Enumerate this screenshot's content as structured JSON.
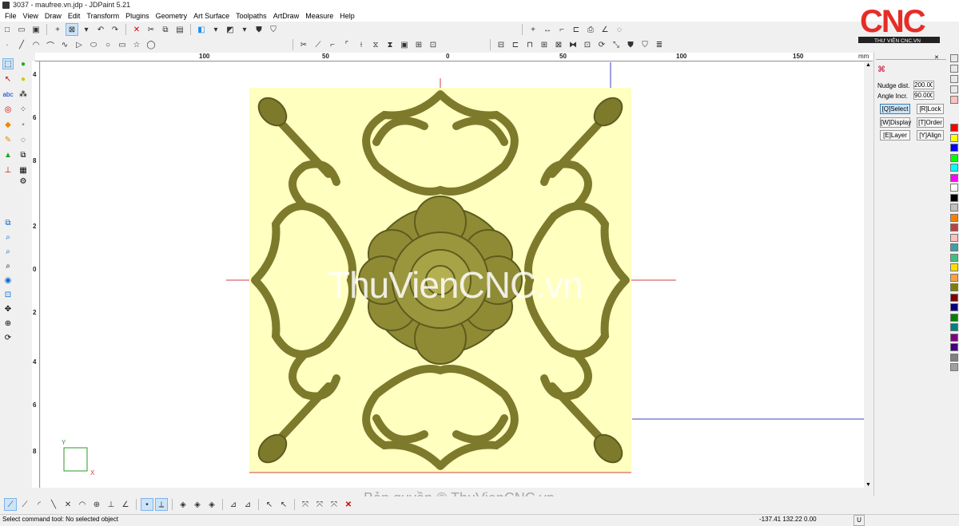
{
  "window": {
    "title": "3037 - maufree.vn.jdp - JDPaint 5.21"
  },
  "menu": [
    "File",
    "View",
    "Draw",
    "Edit",
    "Transform",
    "Plugins",
    "Geometry",
    "Art Surface",
    "Toolpaths",
    "ArtDraw",
    "Measure",
    "Help"
  ],
  "ruler_top": {
    "labels": [
      "100",
      "50",
      "0",
      "50",
      "100",
      "150"
    ],
    "unit": "mm"
  },
  "ruler_left": {
    "labels": [
      "4",
      "6",
      "8",
      "2",
      "0",
      "2",
      "4",
      "6",
      "8"
    ]
  },
  "right_panel": {
    "nudge_label": "Nudge dist.",
    "nudge_value": "200.000",
    "angle_label": "Angle Incr.",
    "angle_value": "90.000",
    "buttons": [
      "[Q]Select",
      "[R]Lock",
      "[W]Display",
      "[T]Order",
      "[E]Layer",
      "[Y]Align"
    ]
  },
  "palette": [
    "#ff0000",
    "#ffff00",
    "#0000ff",
    "#00ff00",
    "#00ffff",
    "#ff00ff",
    "#ffffff",
    "#000000",
    "#c0c0c0",
    "#ff8000",
    "#c04040",
    "#ffc0c0",
    "#40a0a0",
    "#40c080",
    "#ffe000",
    "#ffa040",
    "#808000",
    "#800000",
    "#000080",
    "#008000",
    "#008080",
    "#800080",
    "#400080",
    "#808080",
    "#a0a0a0"
  ],
  "canvas": {
    "axis_x": "X",
    "axis_y": "Y",
    "watermark": "ThuVienCNC.vn",
    "relief_color": "#7d7a2c",
    "relief_bg": "#ffffc0"
  },
  "copyright": "Bản quyền © ThuVienCNC.vn",
  "logo": {
    "brand": "CNC",
    "tagline": "THƯ VIỆN CNC.VN"
  },
  "status": {
    "message": "Select command tool: No selected object",
    "coords": "-137.41 132.22 0.00",
    "mode": "U"
  }
}
